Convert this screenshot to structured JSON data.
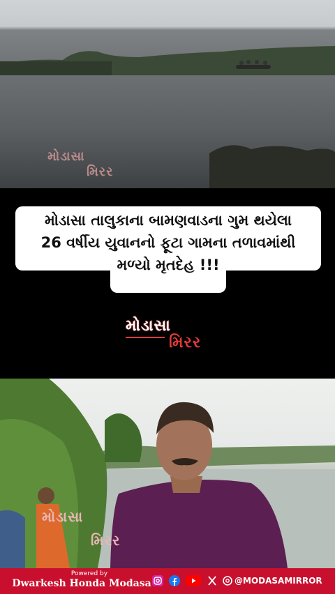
{
  "headline": {
    "line1": "મોડાસા તાલુકાના બામણવાડના ગુમ થયેલા",
    "line2": "26 વર્ષીય યુવાનનો ફૂટા ગામના તળાવમાંથી",
    "line3": "મળ્યો મૃતદેહ !!!"
  },
  "watermark": {
    "word1": "મોડાસા",
    "word2": "મિરર"
  },
  "footer": {
    "powered_by": "Powered by",
    "dealer": "Dwarkesh Honda Modasa",
    "handle": "@MODASAMIRROR",
    "social_icons": [
      "instagram-icon",
      "facebook-icon",
      "youtube-icon",
      "x-icon",
      "threads-icon"
    ],
    "colors": {
      "bar": "#c8102e",
      "instagram": "#d6249f",
      "facebook": "#1877f2",
      "youtube": "#ff0000"
    }
  }
}
